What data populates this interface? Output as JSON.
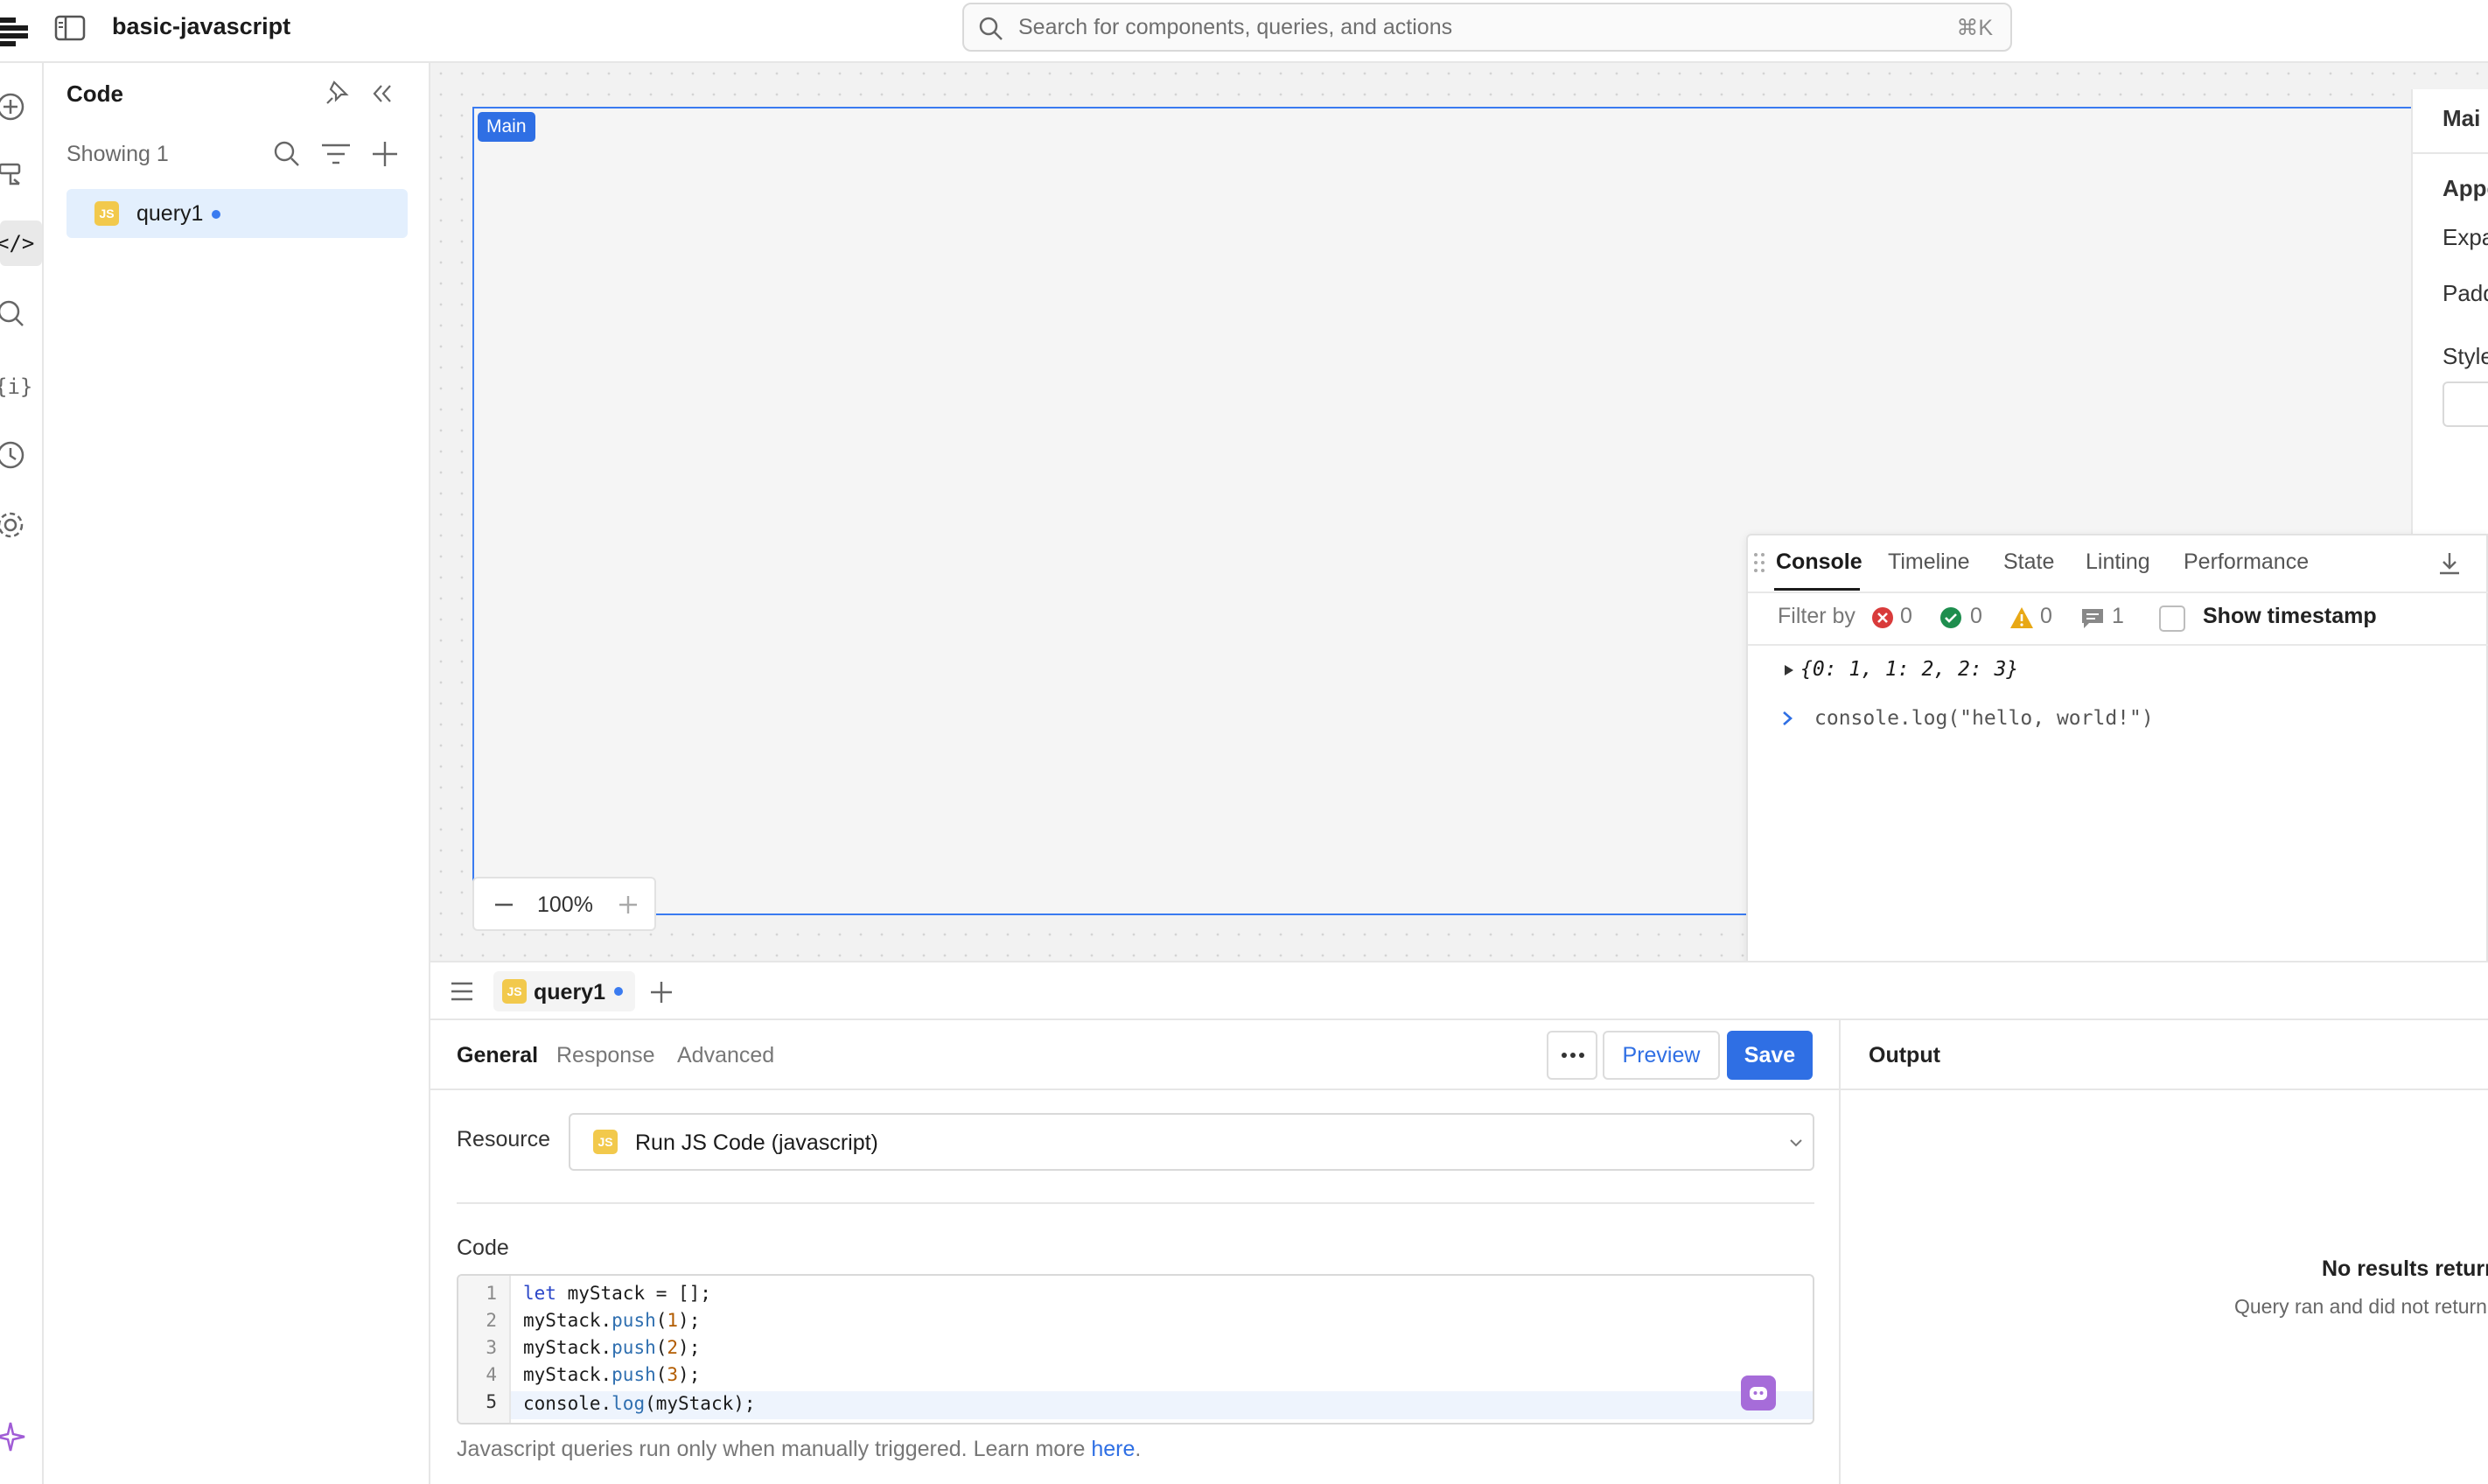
{
  "app": {
    "title": "basic-javascript"
  },
  "search": {
    "placeholder": "Search for components, queries, and actions",
    "shortcut": "⌘K"
  },
  "left_rail": {
    "icons": [
      "add-icon",
      "component-tree-icon",
      "code-icon",
      "search-icon",
      "state-icon",
      "history-icon",
      "settings-icon",
      "ai-sparkle-icon"
    ]
  },
  "sidebar": {
    "title": "Code",
    "showing": "Showing 1",
    "items": [
      {
        "badge": "JS",
        "label": "query1",
        "unsaved": true
      }
    ]
  },
  "canvas": {
    "frame_label": "Main",
    "zoom": "100%"
  },
  "inspector": {
    "title": "Mai",
    "section": "Appe",
    "rows": [
      "Expa",
      "Padd",
      "Style"
    ]
  },
  "debug": {
    "tabs": [
      "Console",
      "Timeline",
      "State",
      "Linting",
      "Performance"
    ],
    "active_tab": "Console",
    "filter_label": "Filter by",
    "counts": {
      "errors": "0",
      "success": "0",
      "warnings": "0",
      "messages": "1"
    },
    "timestamp_label": "Show timestamp",
    "log_object": "{0: 1, 1: 2, 2: 3}",
    "log_command": "console.log(\"hello, world!\")"
  },
  "query_tabs": {
    "tabs": [
      {
        "badge": "JS",
        "label": "query1",
        "unsaved": true
      }
    ]
  },
  "editor": {
    "tabs": [
      "General",
      "Response",
      "Advanced"
    ],
    "active_tab": "General",
    "preview_label": "Preview",
    "save_label": "Save",
    "resource_label": "Resource",
    "resource_value": "Run JS Code (javascript)",
    "resource_badge": "JS",
    "code_label": "Code",
    "code_lines": [
      "let myStack = [];",
      "myStack.push(1);",
      "myStack.push(2);",
      "myStack.push(3);",
      "console.log(myStack);"
    ],
    "line_numbers": [
      "1",
      "2",
      "3",
      "4",
      "5"
    ],
    "footer_text": "Javascript queries run only when manually triggered. Learn more ",
    "footer_link": "here",
    "footer_end": "."
  },
  "output": {
    "title": "Output",
    "empty_title": "No results return",
    "empty_subtitle": "Query ran and did not return"
  },
  "colors": {
    "accent": "#2f6fe4",
    "selection": "#e3effd",
    "js_badge": "#f2c94c",
    "error": "#d93b3b",
    "success": "#1e8e4e",
    "warning": "#e8a815"
  }
}
